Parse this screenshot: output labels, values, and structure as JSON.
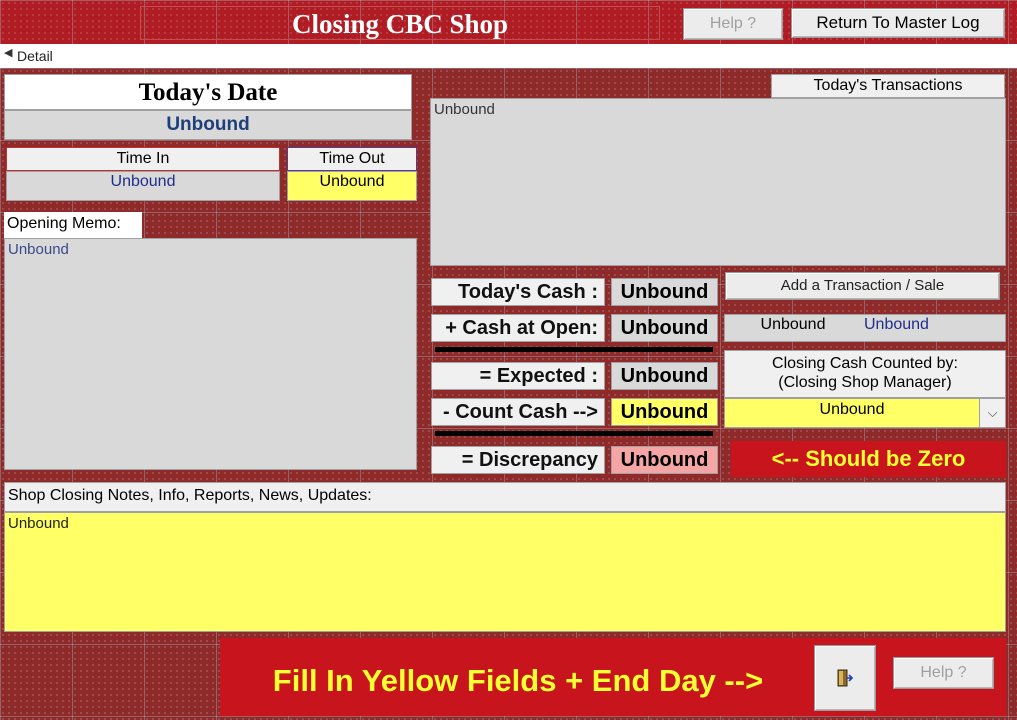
{
  "header": {
    "title": "Closing CBC Shop",
    "help_label": "Help ?",
    "return_label": "Return To Master Log"
  },
  "section": {
    "label": "Detail"
  },
  "left": {
    "todays_date_label": "Today's Date",
    "todays_date_value": "Unbound",
    "time_in_label": "Time In",
    "time_in_value": "Unbound",
    "time_out_label": "Time Out",
    "time_out_value": "Unbound",
    "opening_memo_label": "Opening Memo:",
    "opening_memo_value": "Unbound"
  },
  "right": {
    "todays_transactions_label": "Today's Transactions",
    "todays_transactions_value": "Unbound",
    "add_transaction_label": "Add a Transaction / Sale",
    "transaction_field_1": "Unbound",
    "transaction_field_2": "Unbound",
    "closing_counted_by_label": "Closing Cash Counted by:\n(Closing Shop Manager)",
    "closing_counted_by_value": "Unbound",
    "should_be_zero": "<-- Should be Zero"
  },
  "cash": {
    "todays_cash_label": "Today's Cash :",
    "todays_cash_value": "Unbound",
    "cash_at_open_label": "+ Cash at Open:",
    "cash_at_open_value": "Unbound",
    "expected_label": "= Expected :",
    "expected_value": "Unbound",
    "count_cash_label": "- Count Cash -->",
    "count_cash_value": "Unbound",
    "discrepancy_label": "= Discrepancy",
    "discrepancy_value": "Unbound"
  },
  "notes": {
    "label": "Shop Closing Notes, Info, Reports, News, Updates:",
    "value": "Unbound"
  },
  "footer": {
    "banner": "Fill In Yellow Fields + End Day -->",
    "help_label": "Help ?"
  },
  "colors": {
    "header_red": "#b01c24",
    "grid_maroon": "#8e2a2a",
    "field_yellow": "#ffff66",
    "discrepancy_pink": "#f4a6a6",
    "banner_text": "#ffff33"
  },
  "icons": {
    "section_icon": "caret-icon",
    "exit_icon": "exit-door-icon",
    "dropdown_icon": "chevron-down-icon"
  }
}
